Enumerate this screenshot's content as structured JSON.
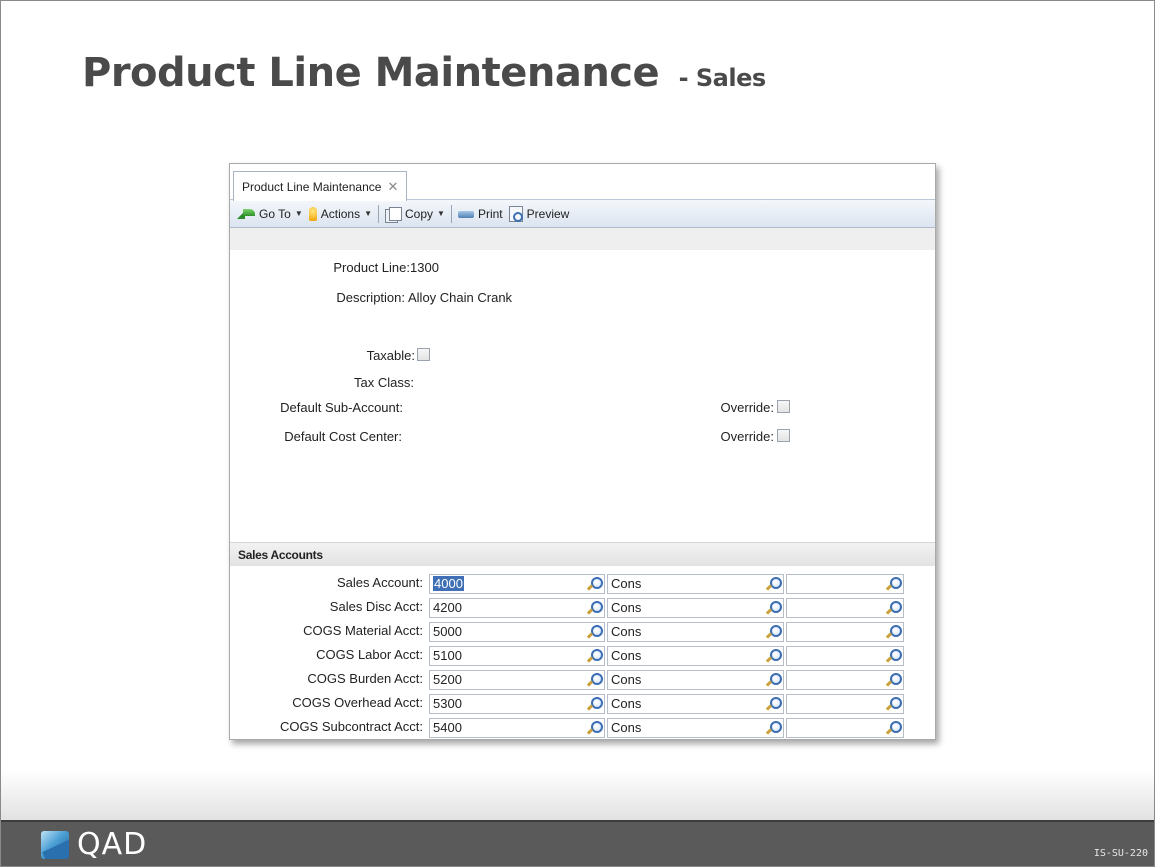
{
  "slide": {
    "title": "Product Line Maintenance",
    "subtitle": "- Sales",
    "logo_text": "QAD",
    "code": "IS-SU-220"
  },
  "window": {
    "tab_label": "Product Line Maintenance",
    "tab_close": "✕",
    "toolbar": {
      "goto": "Go To",
      "actions": "Actions",
      "copy": "Copy",
      "print": "Print",
      "preview": "Preview"
    },
    "form": {
      "product_line_label": "Product Line:",
      "product_line_value": "1300",
      "description_label": "Description:",
      "description_value": "Alloy Chain Crank",
      "taxable_label": "Taxable:",
      "tax_class_label": "Tax Class:",
      "default_sub_account_label": "Default Sub-Account:",
      "default_cost_center_label": "Default Cost Center:",
      "override_label_1": "Override:",
      "override_label_2": "Override:"
    },
    "sales_section": {
      "title": "Sales Accounts",
      "rows": [
        {
          "label": "Sales Account:",
          "account": "4000",
          "sub": "Cons",
          "cc": ""
        },
        {
          "label": "Sales Disc Acct:",
          "account": "4200",
          "sub": "Cons",
          "cc": ""
        },
        {
          "label": "COGS Material Acct:",
          "account": "5000",
          "sub": "Cons",
          "cc": ""
        },
        {
          "label": "COGS Labor Acct:",
          "account": "5100",
          "sub": "Cons",
          "cc": ""
        },
        {
          "label": "COGS Burden Acct:",
          "account": "5200",
          "sub": "Cons",
          "cc": ""
        },
        {
          "label": "COGS Overhead Acct:",
          "account": "5300",
          "sub": "Cons",
          "cc": ""
        },
        {
          "label": "COGS Subcontract Acct:",
          "account": "5400",
          "sub": "Cons",
          "cc": ""
        }
      ]
    }
  }
}
